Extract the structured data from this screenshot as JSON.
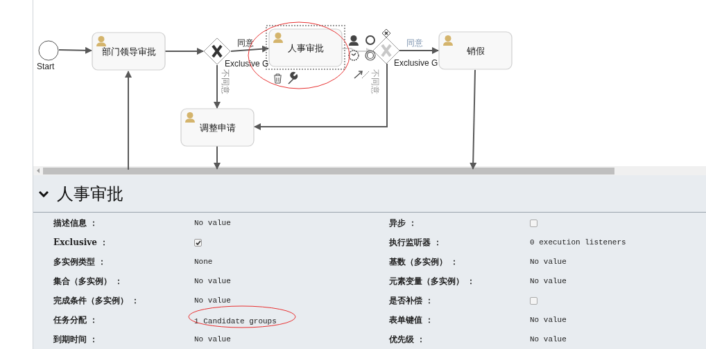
{
  "diagram": {
    "start": {
      "label": "Start"
    },
    "tasks": [
      {
        "label": "部门领导审批",
        "selected": false
      },
      {
        "label": "人事审批",
        "selected": true
      },
      {
        "label": "调整申请",
        "selected": false
      },
      {
        "label": "销假",
        "selected": false
      }
    ],
    "gateways": [
      {
        "label": "Exclusive G"
      },
      {
        "label": "Exclusive G"
      }
    ],
    "edge_labels": [
      "同意",
      "不同意",
      "同意",
      "不同意"
    ]
  },
  "properties": {
    "title": "人事审批",
    "expanded": true,
    "left": [
      {
        "label": "描述信息 ：",
        "kind": "text",
        "value": "No value"
      },
      {
        "label": "Exclusive ：",
        "kind": "checkbox",
        "checked": true
      },
      {
        "label": "多实例类型 ：",
        "kind": "text",
        "value": "None"
      },
      {
        "label": "集合（多实例） ：",
        "kind": "text",
        "value": "No value"
      },
      {
        "label": "完成条件（多实例） ：",
        "kind": "text",
        "value": "No value"
      },
      {
        "label": "任务分配 ：",
        "kind": "text",
        "value": "1 Candidate groups"
      },
      {
        "label": "到期时间 ：",
        "kind": "text",
        "value": "No value"
      }
    ],
    "right": [
      {
        "label": "异步 ：",
        "kind": "checkbox",
        "checked": false
      },
      {
        "label": "执行监听器 ：",
        "kind": "text",
        "value": "0 execution listeners"
      },
      {
        "label": "基数（多实例） ：",
        "kind": "text",
        "value": "No value"
      },
      {
        "label": "元素变量（多实例） ：",
        "kind": "text",
        "value": "No value"
      },
      {
        "label": "是否补偿 ：",
        "kind": "checkbox",
        "checked": false
      },
      {
        "label": "表单键值 ：",
        "kind": "text",
        "value": "No value"
      },
      {
        "label": "优先级 ：",
        "kind": "text",
        "value": "No value"
      }
    ]
  }
}
